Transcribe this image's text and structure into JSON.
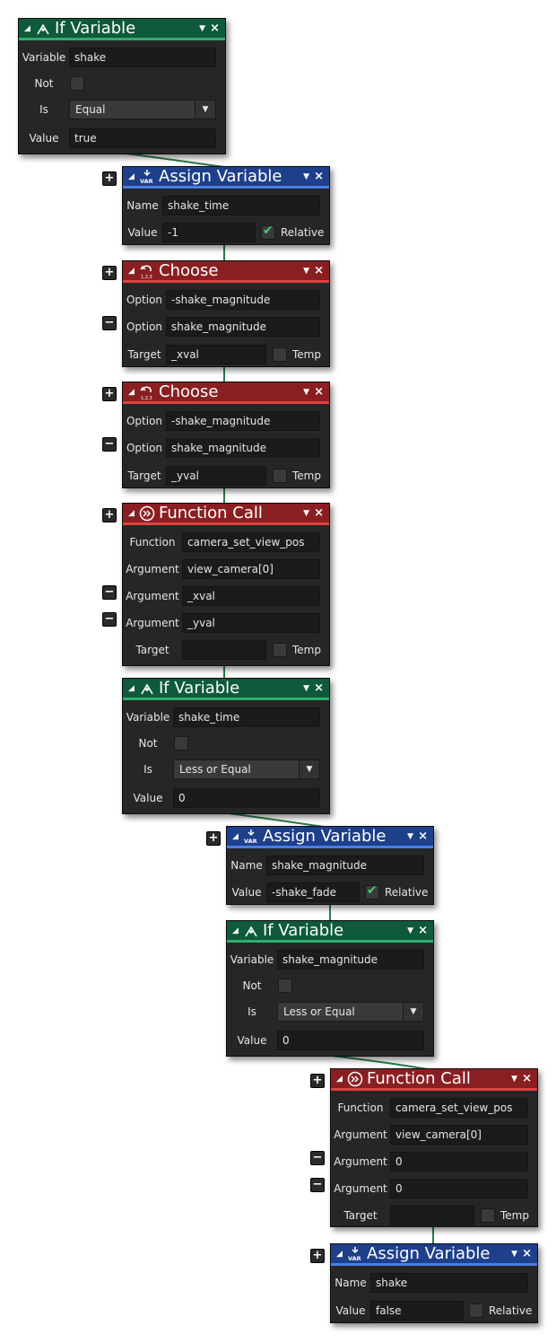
{
  "colors": {
    "green": "#0e5a3a",
    "blue": "#1e3f8a",
    "red": "#8a1f22",
    "wire": "#2a7a4a"
  },
  "blocks": [
    {
      "title": "If Variable",
      "icon": "if-variable-icon",
      "rows": [
        {
          "label": "Variable",
          "value": "shake"
        },
        {
          "label": "Not",
          "checked": false
        },
        {
          "label": "Is",
          "select": "Equal"
        },
        {
          "label": "Value",
          "value": "true"
        }
      ]
    },
    {
      "title": "Assign Variable",
      "icon": "var-icon",
      "rows": [
        {
          "label": "Name",
          "value": "shake_time"
        },
        {
          "label": "Value",
          "value": "-1",
          "check_label": "Relative",
          "checked": true
        }
      ]
    },
    {
      "title": "Choose",
      "icon": "choose-icon",
      "rows": [
        {
          "label": "Option",
          "value": "-shake_magnitude"
        },
        {
          "label": "Option",
          "value": "shake_magnitude"
        },
        {
          "label": "Target",
          "value": "_xval",
          "check_label": "Temp",
          "checked": false
        }
      ]
    },
    {
      "title": "Choose",
      "icon": "choose-icon",
      "rows": [
        {
          "label": "Option",
          "value": "-shake_magnitude"
        },
        {
          "label": "Option",
          "value": "shake_magnitude"
        },
        {
          "label": "Target",
          "value": "_yval",
          "check_label": "Temp",
          "checked": false
        }
      ]
    },
    {
      "title": "Function Call",
      "icon": "function-call-icon",
      "rows": [
        {
          "label": "Function",
          "value": "camera_set_view_pos"
        },
        {
          "label": "Argument",
          "value": "view_camera[0]"
        },
        {
          "label": "Argument",
          "value": "_xval"
        },
        {
          "label": "Argument",
          "value": "_yval"
        },
        {
          "label": "Target",
          "value": "",
          "check_label": "Temp",
          "checked": false
        }
      ]
    },
    {
      "title": "If Variable",
      "icon": "if-variable-icon",
      "rows": [
        {
          "label": "Variable",
          "value": "shake_time"
        },
        {
          "label": "Not",
          "checked": false
        },
        {
          "label": "Is",
          "select": "Less or Equal"
        },
        {
          "label": "Value",
          "value": "0"
        }
      ]
    },
    {
      "title": "Assign Variable",
      "icon": "var-icon",
      "rows": [
        {
          "label": "Name",
          "value": "shake_magnitude"
        },
        {
          "label": "Value",
          "value": "-shake_fade",
          "check_label": "Relative",
          "checked": true
        }
      ]
    },
    {
      "title": "If Variable",
      "icon": "if-variable-icon",
      "rows": [
        {
          "label": "Variable",
          "value": "shake_magnitude"
        },
        {
          "label": "Not",
          "checked": false
        },
        {
          "label": "Is",
          "select": "Less or Equal"
        },
        {
          "label": "Value",
          "value": "0"
        }
      ]
    },
    {
      "title": "Function Call",
      "icon": "function-call-icon",
      "rows": [
        {
          "label": "Function",
          "value": "camera_set_view_pos"
        },
        {
          "label": "Argument",
          "value": "view_camera[0]"
        },
        {
          "label": "Argument",
          "value": "0"
        },
        {
          "label": "Argument",
          "value": "0"
        },
        {
          "label": "Target",
          "value": "",
          "check_label": "Temp",
          "checked": false
        }
      ]
    },
    {
      "title": "Assign Variable",
      "icon": "var-icon",
      "rows": [
        {
          "label": "Name",
          "value": "shake"
        },
        {
          "label": "Value",
          "value": "false",
          "check_label": "Relative",
          "checked": false
        }
      ]
    }
  ]
}
